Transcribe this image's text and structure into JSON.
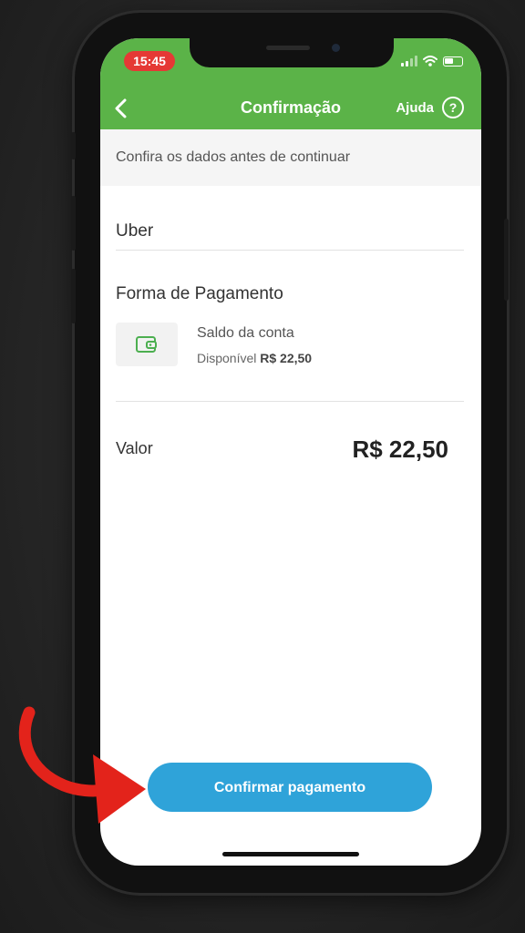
{
  "status_bar": {
    "time": "15:45"
  },
  "header": {
    "title": "Confirmação",
    "help_label": "Ajuda",
    "help_icon": "question-circle-icon",
    "back_icon": "chevron-left-icon"
  },
  "subheader": {
    "text": "Confira os dados antes de continuar"
  },
  "merchant": {
    "name": "Uber"
  },
  "payment_method": {
    "section_label": "Forma de Pagamento",
    "icon": "wallet-icon",
    "name": "Saldo da conta",
    "available_label": "Disponível",
    "available_amount": "R$ 22,50"
  },
  "amount": {
    "label": "Valor",
    "value": "R$ 22,50"
  },
  "confirm_button": {
    "label": "Confirmar pagamento"
  },
  "colors": {
    "header_green": "#5bb348",
    "button_blue": "#2fa3d9",
    "time_pill_red": "#e53935",
    "annotation_arrow_red": "#e3231b"
  }
}
